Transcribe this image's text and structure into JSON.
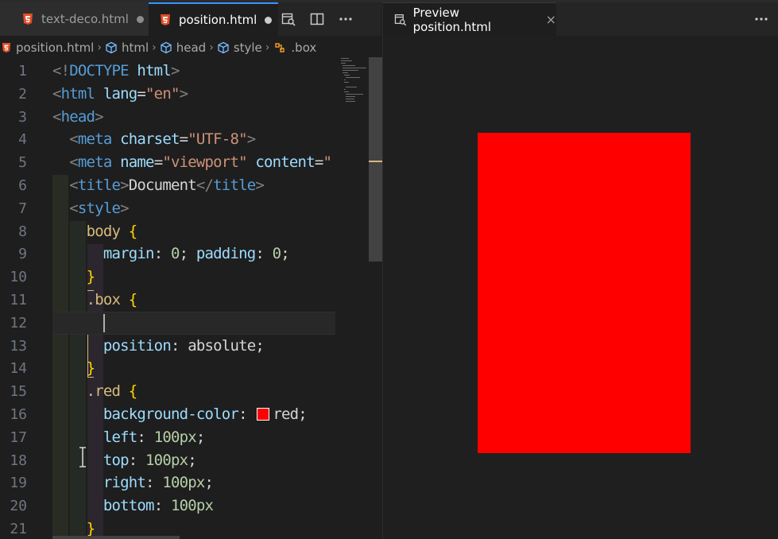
{
  "editor_tabs": [
    {
      "label": "text-deco.html",
      "dirty": true,
      "icon": "html5-icon"
    },
    {
      "label": "position.html",
      "dirty": true,
      "active": true,
      "icon": "html5-icon"
    }
  ],
  "tab_actions": [
    "open-preview-icon",
    "split-editor-icon",
    "more-actions-icon"
  ],
  "breadcrumb": [
    "position.html",
    "html",
    "head",
    "style",
    ".box"
  ],
  "lines": [
    [
      [
        "br",
        "<!"
      ],
      [
        "tag",
        "DOCTYPE"
      ],
      [
        "plain",
        " "
      ],
      [
        "attr",
        "html"
      ],
      [
        "br",
        ">"
      ]
    ],
    [
      [
        "br",
        "<"
      ],
      [
        "tag",
        "html"
      ],
      [
        "plain",
        " "
      ],
      [
        "attr",
        "lang"
      ],
      [
        "plain",
        "="
      ],
      [
        "str",
        "\"en\""
      ],
      [
        "br",
        ">"
      ]
    ],
    [
      [
        "br",
        "<"
      ],
      [
        "tag",
        "head"
      ],
      [
        "br",
        ">"
      ]
    ],
    [
      [
        "plain",
        "  "
      ],
      [
        "br",
        "<"
      ],
      [
        "tag",
        "meta"
      ],
      [
        "plain",
        " "
      ],
      [
        "attr",
        "charset"
      ],
      [
        "plain",
        "="
      ],
      [
        "str",
        "\"UTF-8\""
      ],
      [
        "br",
        ">"
      ]
    ],
    [
      [
        "plain",
        "  "
      ],
      [
        "br",
        "<"
      ],
      [
        "tag",
        "meta"
      ],
      [
        "plain",
        " "
      ],
      [
        "attr",
        "name"
      ],
      [
        "plain",
        "="
      ],
      [
        "str",
        "\"viewport\""
      ],
      [
        "plain",
        " "
      ],
      [
        "attr",
        "content"
      ],
      [
        "plain",
        "="
      ],
      [
        "str",
        "\""
      ]
    ],
    [
      [
        "plain",
        "  "
      ],
      [
        "br",
        "<"
      ],
      [
        "tag",
        "title"
      ],
      [
        "br",
        ">"
      ],
      [
        "plain",
        "Document"
      ],
      [
        "br",
        "</"
      ],
      [
        "tag",
        "title"
      ],
      [
        "br",
        ">"
      ]
    ],
    [
      [
        "plain",
        "  "
      ],
      [
        "br",
        "<"
      ],
      [
        "tag",
        "style"
      ],
      [
        "br",
        ">"
      ]
    ],
    [
      [
        "plain",
        "    "
      ],
      [
        "sel",
        "body"
      ],
      [
        "plain",
        " "
      ],
      [
        "curly",
        "{"
      ]
    ],
    [
      [
        "plain",
        "      "
      ],
      [
        "prop",
        "margin"
      ],
      [
        "plain",
        ": "
      ],
      [
        "num",
        "0"
      ],
      [
        "plain",
        "; "
      ],
      [
        "prop",
        "padding"
      ],
      [
        "plain",
        ": "
      ],
      [
        "num",
        "0"
      ],
      [
        "plain",
        ";"
      ]
    ],
    [
      [
        "plain",
        "    "
      ],
      [
        "curly",
        "}"
      ]
    ],
    [
      [
        "plain",
        "    "
      ],
      [
        "sel",
        ".box"
      ],
      [
        "plain",
        " "
      ],
      [
        "curly",
        "{"
      ]
    ],
    [],
    [
      [
        "plain",
        "      "
      ],
      [
        "prop",
        "position"
      ],
      [
        "plain",
        ": "
      ],
      [
        "plain",
        "absolute"
      ],
      [
        "plain",
        ";"
      ]
    ],
    [
      [
        "plain",
        "    "
      ],
      [
        "curly",
        "}"
      ]
    ],
    [
      [
        "plain",
        "    "
      ],
      [
        "sel",
        ".red"
      ],
      [
        "plain",
        " "
      ],
      [
        "curly",
        "{"
      ]
    ],
    [
      [
        "plain",
        "      "
      ],
      [
        "prop",
        "background-color"
      ],
      [
        "plain",
        ": "
      ],
      [
        "swatch",
        ""
      ],
      [
        "plain",
        "red"
      ],
      [
        "plain",
        ";"
      ]
    ],
    [
      [
        "plain",
        "      "
      ],
      [
        "prop",
        "left"
      ],
      [
        "plain",
        ": "
      ],
      [
        "num",
        "100px"
      ],
      [
        "plain",
        ";"
      ]
    ],
    [
      [
        "plain",
        "      "
      ],
      [
        "prop",
        "top"
      ],
      [
        "plain",
        ": "
      ],
      [
        "num",
        "100px"
      ],
      [
        "plain",
        ";"
      ]
    ],
    [
      [
        "plain",
        "      "
      ],
      [
        "prop",
        "right"
      ],
      [
        "plain",
        ": "
      ],
      [
        "num",
        "100px"
      ],
      [
        "plain",
        ";"
      ]
    ],
    [
      [
        "plain",
        "      "
      ],
      [
        "prop",
        "bottom"
      ],
      [
        "plain",
        ": "
      ],
      [
        "num",
        "100px"
      ]
    ],
    [
      [
        "plain",
        "    "
      ],
      [
        "curly",
        "}"
      ]
    ]
  ],
  "line_numbers": [
    "1",
    "2",
    "3",
    "4",
    "5",
    "6",
    "7",
    "8",
    "9",
    "10",
    "11",
    "12",
    "13",
    "14",
    "15",
    "16",
    "17",
    "18",
    "19",
    "20",
    "21"
  ],
  "current_line": 12,
  "preview_tab": {
    "label": "Preview position.html",
    "close": "×",
    "icon": "preview-icon"
  },
  "colors": {
    "accent": "#3794ff",
    "preview_box": "#ff0000",
    "bg": "#1e1e1e"
  }
}
